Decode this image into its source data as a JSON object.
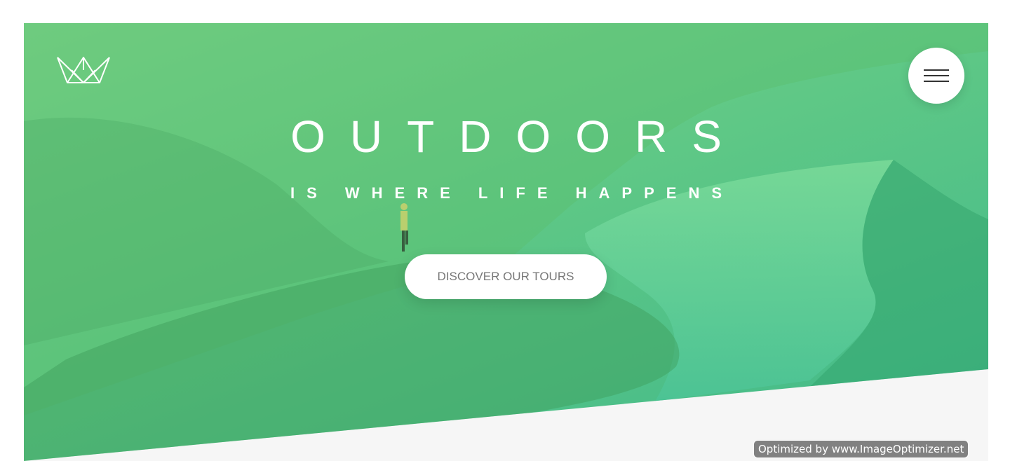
{
  "hero": {
    "title": "OUTDOORS",
    "subtitle": "IS WHERE LIFE HAPPENS",
    "cta_label": "DISCOVER OUR TOURS"
  },
  "header": {
    "logo_icon": "crown-icon",
    "menu_icon": "hamburger-menu-icon"
  },
  "watermark": {
    "text": "Optimized by www.ImageOptimizer.net"
  },
  "colors": {
    "gradient_light": "#7fd68c",
    "gradient_dark": "#3fb88a",
    "button_bg": "#ffffff",
    "button_text": "#777777",
    "page_bg": "#f6f6f6"
  }
}
